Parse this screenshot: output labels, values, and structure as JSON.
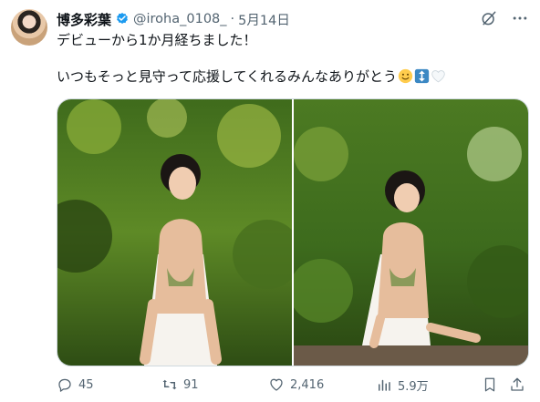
{
  "tweet": {
    "author_name": "博多彩葉",
    "handle": "@iroha_0108_",
    "separator": "·",
    "date": "5月14日",
    "line1": "デビューから1か月経ちました！",
    "line2": "いつもそっと見守って応援してくれるみんなありがとう"
  },
  "icons": {
    "verified": "verified-badge-icon",
    "grok": "grok-icon",
    "more": "more-icon",
    "emoji1": "slightly-smiling-face-emoji",
    "emoji2": "up-down-arrow-emoji",
    "emoji3": "white-heart-emoji"
  },
  "colors": {
    "accent": "#1d9bf0",
    "muted": "#536471",
    "text": "#0f1419"
  },
  "actions": {
    "replies": "45",
    "reposts": "91",
    "likes": "2,416",
    "views": "5.9万"
  }
}
